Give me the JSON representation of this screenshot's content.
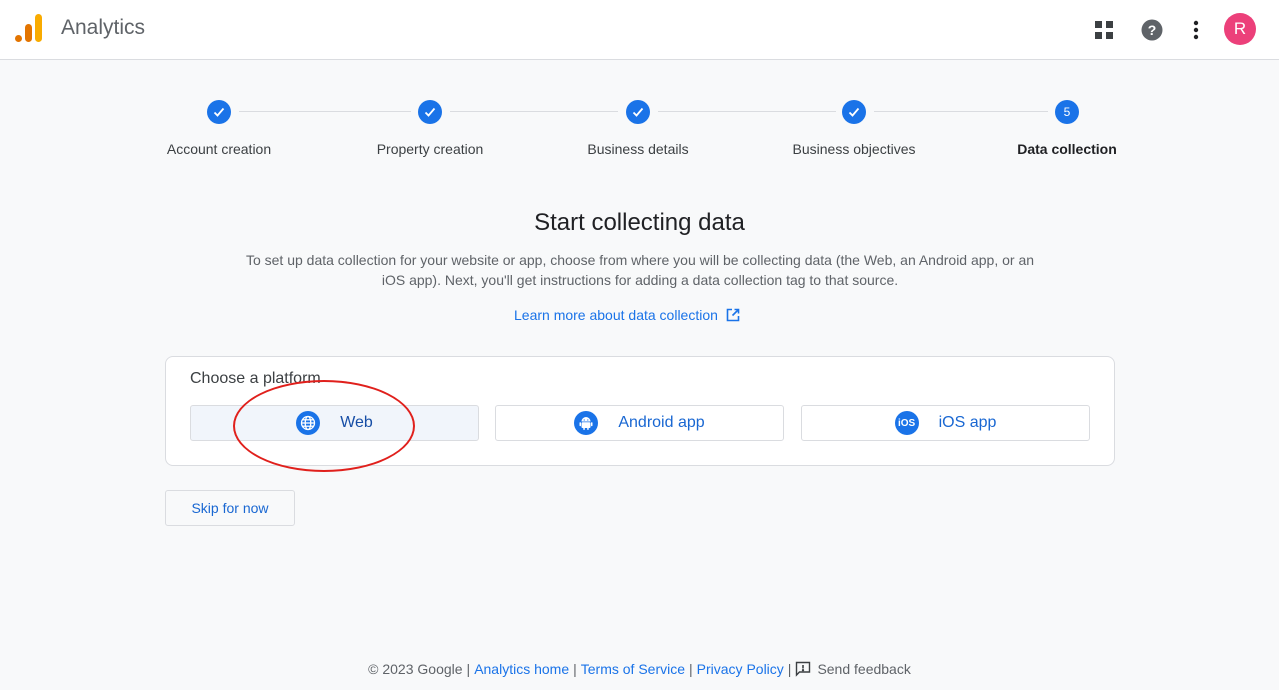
{
  "header": {
    "app_title": "Analytics",
    "avatar_initial": "R",
    "avatar_color": "#ec407a",
    "icons": [
      "apps-grid-icon",
      "help-icon",
      "more-vert-icon"
    ]
  },
  "stepper": {
    "steps": [
      {
        "label": "Account creation",
        "status": "done"
      },
      {
        "label": "Property creation",
        "status": "done"
      },
      {
        "label": "Business details",
        "status": "done"
      },
      {
        "label": "Business objectives",
        "status": "done"
      },
      {
        "label": "Data collection",
        "status": "active",
        "number": "5"
      }
    ]
  },
  "main": {
    "heading": "Start collecting data",
    "description": "To set up data collection for your website or app, choose from where you will be collecting data (the Web, an Android app, or an iOS app). Next, you'll get instructions for adding a data collection tag to that source.",
    "learn_more": "Learn more about data collection",
    "platform_card": {
      "title": "Choose a platform",
      "options": [
        {
          "label": "Web",
          "icon": "globe-icon"
        },
        {
          "label": "Android app",
          "icon": "android-icon"
        },
        {
          "label": "iOS app",
          "icon": "ios-icon",
          "icon_text": "iOS"
        }
      ]
    },
    "skip_label": "Skip for now"
  },
  "footer": {
    "copyright": "© 2023 Google",
    "analytics_home": "Analytics home",
    "terms": "Terms of Service",
    "privacy": "Privacy Policy",
    "feedback": "Send feedback"
  },
  "colors": {
    "accent": "#1a73e8",
    "annotation": "#e0201c"
  }
}
